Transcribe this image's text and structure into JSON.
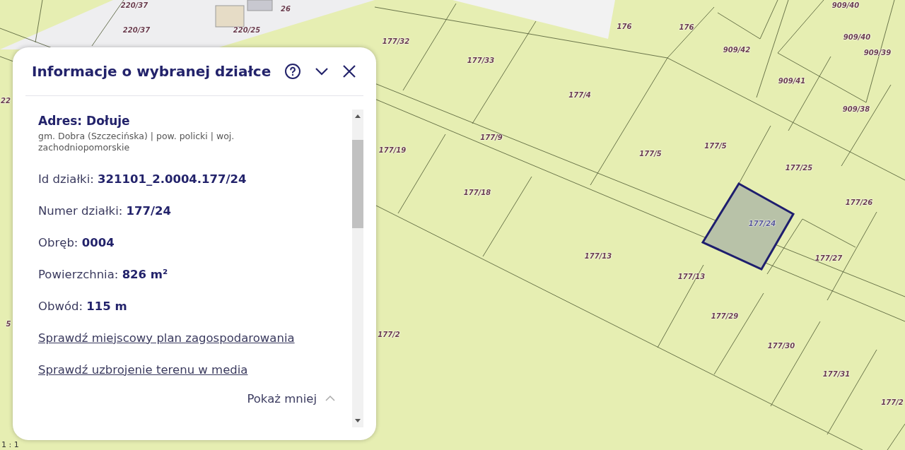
{
  "map": {
    "labels": [
      {
        "text": "220/37",
        "selected": false
      },
      {
        "text": "26",
        "selected": false
      },
      {
        "text": "220/37",
        "selected": false
      },
      {
        "text": "220/25",
        "selected": false
      },
      {
        "text": "22",
        "selected": false
      },
      {
        "text": "5",
        "selected": false
      },
      {
        "text": "177/32",
        "selected": false
      },
      {
        "text": "176",
        "selected": false
      },
      {
        "text": "176",
        "selected": false
      },
      {
        "text": "909/40",
        "selected": false
      },
      {
        "text": "909/40",
        "selected": false
      },
      {
        "text": "909/39",
        "selected": false
      },
      {
        "text": "909/42",
        "selected": false
      },
      {
        "text": "177/33",
        "selected": false
      },
      {
        "text": "177/4",
        "selected": false
      },
      {
        "text": "909/41",
        "selected": false
      },
      {
        "text": "909/38",
        "selected": false
      },
      {
        "text": "177/9",
        "selected": false
      },
      {
        "text": "177/19",
        "selected": false
      },
      {
        "text": "177/5",
        "selected": false
      },
      {
        "text": "177/5",
        "selected": false
      },
      {
        "text": "177/25",
        "selected": false
      },
      {
        "text": "177/18",
        "selected": false
      },
      {
        "text": "177/26",
        "selected": false
      },
      {
        "text": "177/24",
        "selected": true
      },
      {
        "text": "177/13",
        "selected": false
      },
      {
        "text": "177/27",
        "selected": false
      },
      {
        "text": "177/13",
        "selected": false
      },
      {
        "text": "177/29",
        "selected": false
      },
      {
        "text": "177/2",
        "selected": false
      },
      {
        "text": "177/30",
        "selected": false
      },
      {
        "text": "177/31",
        "selected": false
      },
      {
        "text": "177/2",
        "selected": false
      }
    ],
    "scale": "1 : 1"
  },
  "panel": {
    "title": "Informacje o wybranej działce",
    "address": {
      "title": "Adres: Dołuje",
      "subtitle": "gm. Dobra (Szczecińska) | pow. policki | woj. zachodniopomorskie"
    },
    "fields": [
      {
        "label": "Id działki:",
        "value": "321101_2.0004.177/24"
      },
      {
        "label": "Numer działki:",
        "value": "177/24"
      },
      {
        "label": "Obręb:",
        "value": "0004"
      },
      {
        "label": "Powierzchnia:",
        "value": "826 m²"
      },
      {
        "label": "Obwód:",
        "value": "115 m"
      }
    ],
    "links": [
      "Sprawdź miejscowy plan zagospodarowania",
      "Sprawdź uzbrojenie terenu w media"
    ],
    "toggle": {
      "label": "Pokaż mniej",
      "expanded": true
    }
  }
}
